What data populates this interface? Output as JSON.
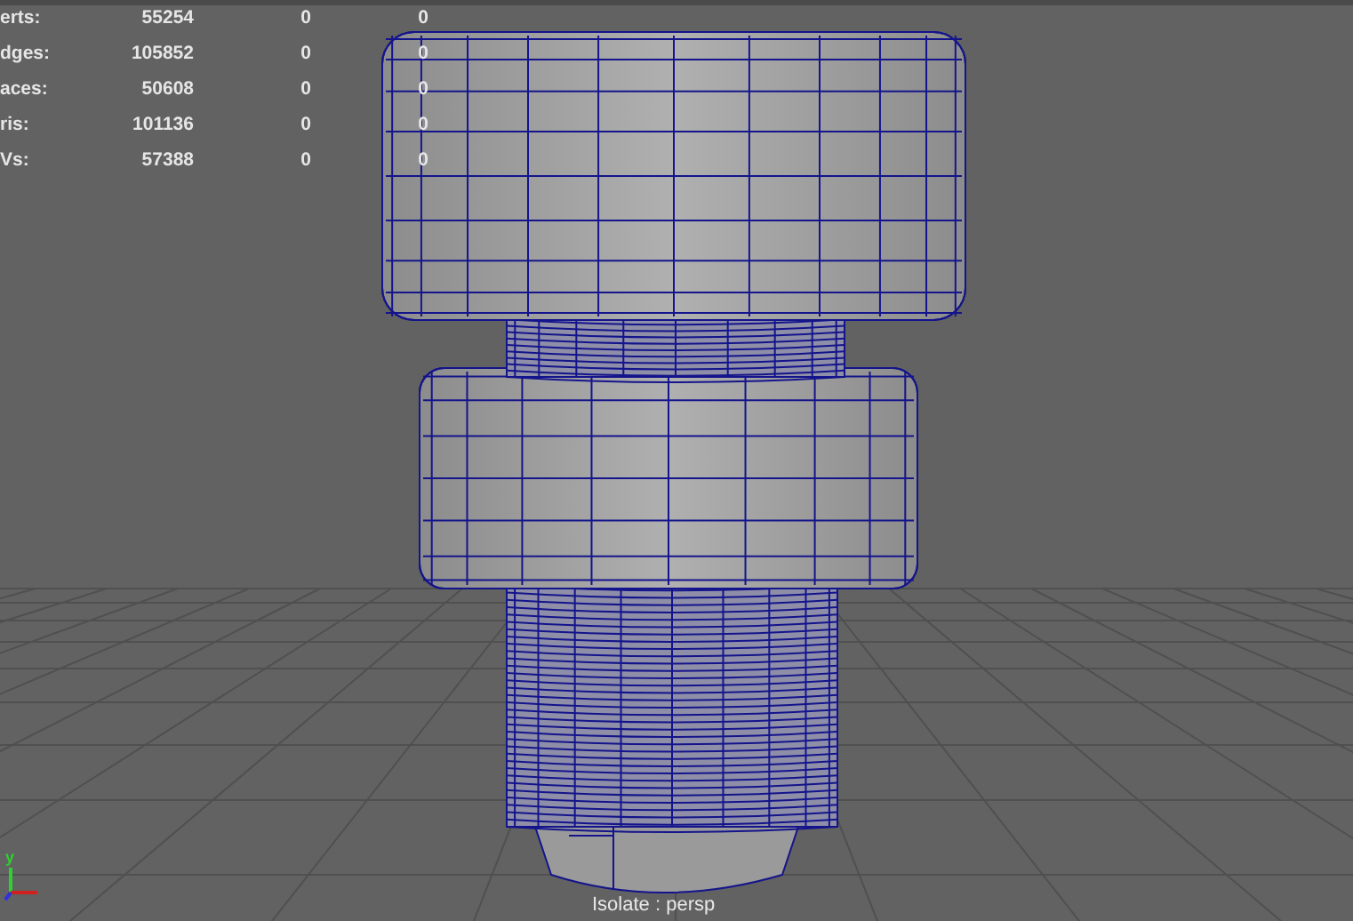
{
  "hud_stats": [
    {
      "label": "erts:",
      "values": [
        "55254",
        "0",
        "0"
      ]
    },
    {
      "label": "dges:",
      "values": [
        "105852",
        "0",
        "0"
      ]
    },
    {
      "label": "aces:",
      "values": [
        "50608",
        "0",
        "0"
      ]
    },
    {
      "label": "ris:",
      "values": [
        "101136",
        "0",
        "0"
      ]
    },
    {
      "label": "Vs:",
      "values": [
        "57388",
        "0",
        "0"
      ]
    }
  ],
  "axis_label": "y",
  "isolate_label": "Isolate : persp"
}
